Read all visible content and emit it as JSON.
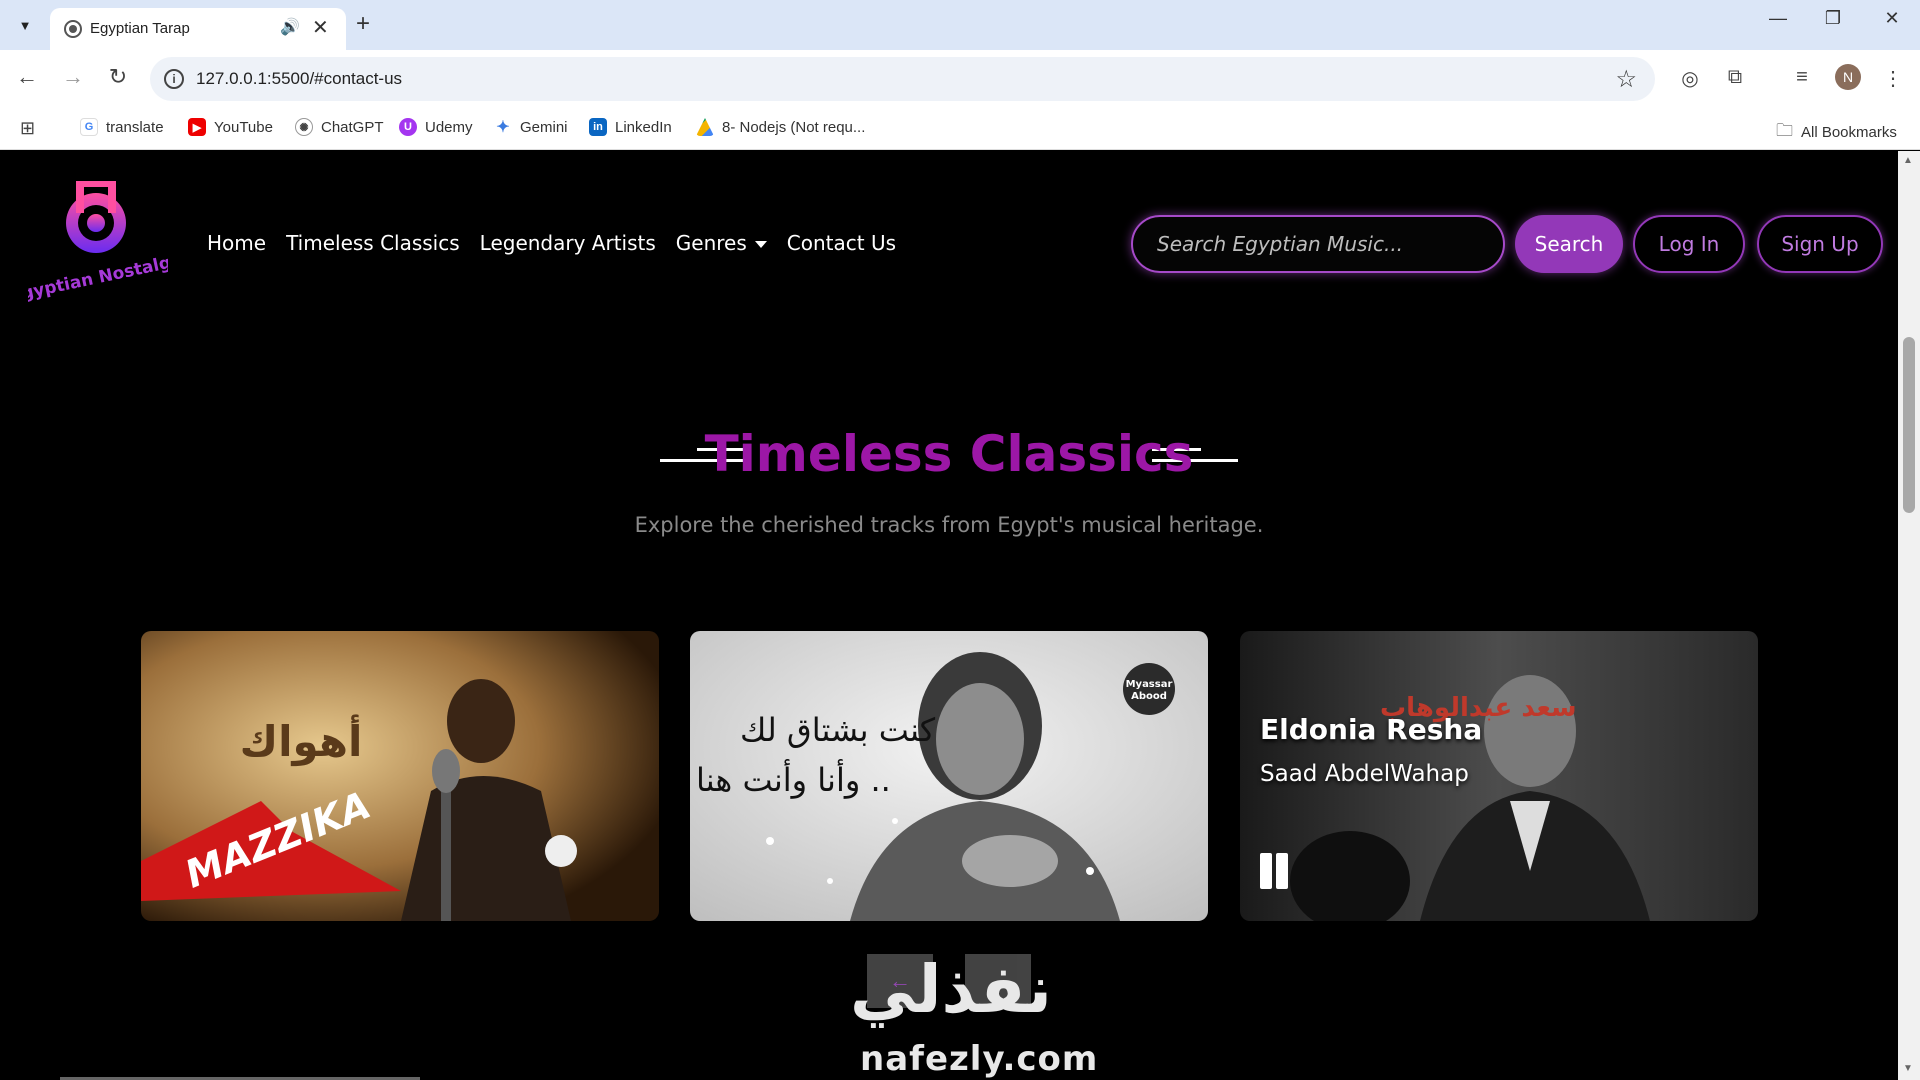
{
  "browser": {
    "tab_title": "Egyptian Tarap",
    "url": "127.0.0.1:5500/#contact-us",
    "profile_initial": "N",
    "bookmarks": [
      {
        "label": "translate",
        "icon": "google-icon"
      },
      {
        "label": "YouTube",
        "icon": "youtube-icon"
      },
      {
        "label": "ChatGPT",
        "icon": "chatgpt-icon"
      },
      {
        "label": "Udemy",
        "icon": "udemy-icon"
      },
      {
        "label": "Gemini",
        "icon": "gemini-icon"
      },
      {
        "label": "LinkedIn",
        "icon": "linkedin-icon"
      },
      {
        "label": "8- Nodejs (Not requ...",
        "icon": "drive-icon"
      }
    ],
    "all_bookmarks": "All Bookmarks"
  },
  "site": {
    "logo_text": "Egyptian Nostalgia",
    "nav": {
      "home": "Home",
      "timeless": "Timeless Classics",
      "legendary": "Legendary Artists",
      "genres": "Genres",
      "contact": "Contact Us"
    },
    "search_placeholder": "Search Egyptian Music...",
    "search_btn": "Search",
    "login_btn": "Log In",
    "signup_btn": "Sign Up"
  },
  "section": {
    "title": "Timeless Classics",
    "subtitle": "Explore the cherished tracks from Egypt's musical heritage."
  },
  "cards": [
    {
      "image_text": "أهواك",
      "badge": "MAZZIKA"
    },
    {
      "image_text_line1": "كنت بشتاق لك",
      "image_text_line2": "وأنا وأنت هنا ..",
      "badge_line1": "Myassar",
      "badge_line2": "Abood"
    },
    {
      "title": "Eldonia Resha",
      "artist": "Saad AbdelWahap",
      "overlay_text": "سعد عبدالوهاب"
    }
  ],
  "carousel": {
    "prev": "←",
    "next": "→"
  },
  "watermark": {
    "arabic": "نفذلي",
    "latin": "nafezly.com"
  },
  "colors": {
    "accent": "#9338b8",
    "title": "#9c17a6"
  }
}
